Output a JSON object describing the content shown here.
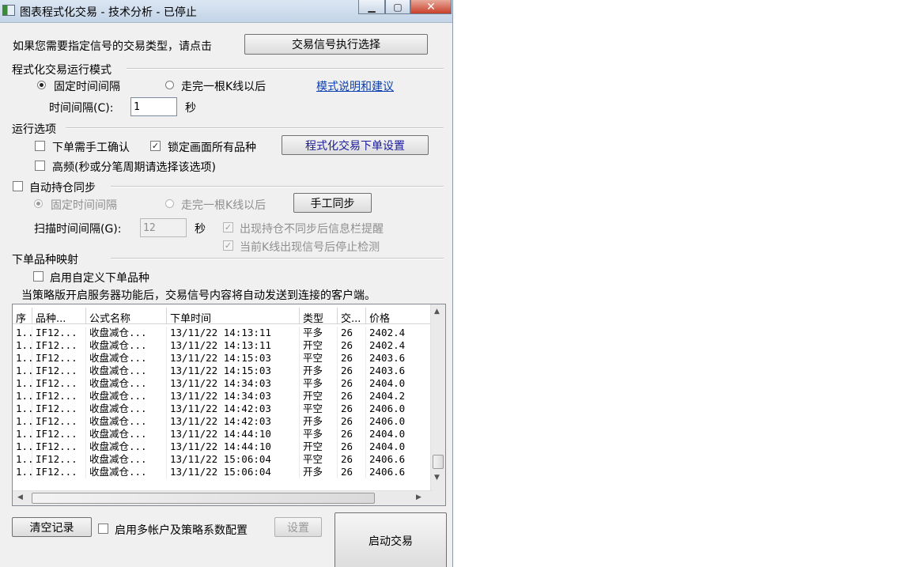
{
  "window": {
    "title": "图表程式化交易 - 技术分析 - 已停止"
  },
  "signal_prompt": "如果您需要指定信号的交易类型，请点击",
  "signal_button": "交易信号执行选择",
  "mode": {
    "label": "程式化交易运行模式",
    "fixed": "固定时间间隔",
    "after_bar": "走完一根K线以后",
    "help_link": "模式说明和建议",
    "interval_label": "时间间隔(C):",
    "interval_value": "1",
    "unit": "秒"
  },
  "options": {
    "label": "运行选项",
    "manual_confirm": "下单需手工确认",
    "lock_all": "锁定画面所有品种",
    "order_settings": "程式化交易下单设置",
    "high_freq": "高频(秒或分笔周期请选择该选项)"
  },
  "sync": {
    "auto_label": "自动持仓同步",
    "fixed": "固定时间间隔",
    "after_bar": "走完一根K线以后",
    "manual_sync": "手工同步",
    "scan_label": "扫描时间间隔(G):",
    "scan_value": "12",
    "unit": "秒",
    "remind": "出现持仓不同步后信息栏提醒",
    "stop_detect": "当前K线出现信号后停止检测"
  },
  "mapping": {
    "label": "下单品种映射",
    "custom": "启用自定义下单品种",
    "note": "当策略版开启服务器功能后，交易信号内容将自动发送到连接的客户端。"
  },
  "table": {
    "columns": [
      "序",
      "品种...",
      "公式名称",
      "下单时间",
      "类型",
      "交...",
      "价格"
    ],
    "rows": [
      [
        "1...",
        "IF12...",
        "收盘减仓...",
        "13/11/22 14:13:11",
        "平多",
        "26",
        "2402.4"
      ],
      [
        "1...",
        "IF12...",
        "收盘减仓...",
        "13/11/22 14:13:11",
        "开空",
        "26",
        "2402.4"
      ],
      [
        "1...",
        "IF12...",
        "收盘减仓...",
        "13/11/22 14:15:03",
        "平空",
        "26",
        "2403.6"
      ],
      [
        "1...",
        "IF12...",
        "收盘减仓...",
        "13/11/22 14:15:03",
        "开多",
        "26",
        "2403.6"
      ],
      [
        "1...",
        "IF12...",
        "收盘减仓...",
        "13/11/22 14:34:03",
        "平多",
        "26",
        "2404.0"
      ],
      [
        "1...",
        "IF12...",
        "收盘减仓...",
        "13/11/22 14:34:03",
        "开空",
        "26",
        "2404.2"
      ],
      [
        "1...",
        "IF12...",
        "收盘减仓...",
        "13/11/22 14:42:03",
        "平空",
        "26",
        "2406.0"
      ],
      [
        "1...",
        "IF12...",
        "收盘减仓...",
        "13/11/22 14:42:03",
        "开多",
        "26",
        "2406.0"
      ],
      [
        "1...",
        "IF12...",
        "收盘减仓...",
        "13/11/22 14:44:10",
        "平多",
        "26",
        "2404.0"
      ],
      [
        "1...",
        "IF12...",
        "收盘减仓...",
        "13/11/22 14:44:10",
        "开空",
        "26",
        "2404.0"
      ],
      [
        "1...",
        "IF12...",
        "收盘减仓...",
        "13/11/22 15:06:04",
        "平空",
        "26",
        "2406.6"
      ],
      [
        "1...",
        "IF12...",
        "收盘减仓...",
        "13/11/22 15:06:04",
        "开多",
        "26",
        "2406.6"
      ]
    ]
  },
  "bottom": {
    "clear": "清空记录",
    "multi_account": "启用多帐户及策略系数配置",
    "settings": "设置",
    "start": "启动交易"
  },
  "icons": {
    "minimize": "minimize-icon",
    "maximize": "maximize-icon",
    "close": "close-icon",
    "check_mark": "✓"
  }
}
